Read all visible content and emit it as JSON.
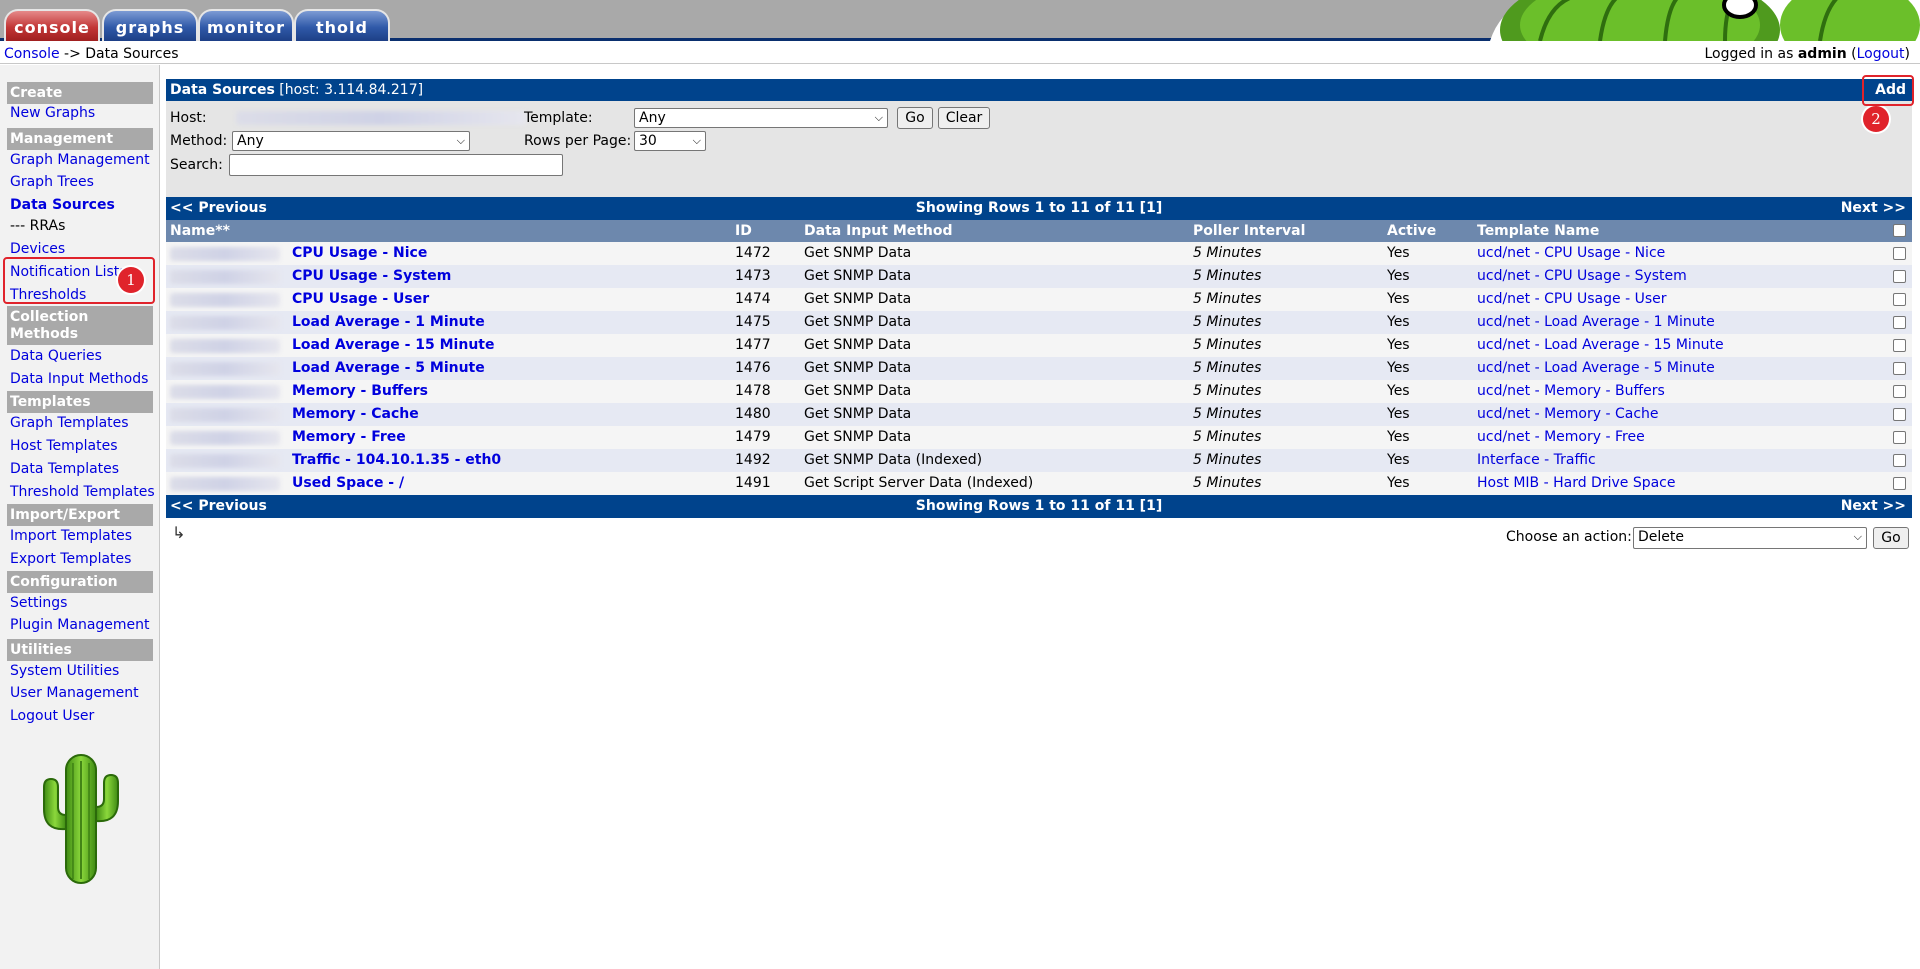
{
  "tabs": [
    {
      "label": "console",
      "active": true
    },
    {
      "label": "graphs"
    },
    {
      "label": "monitor"
    },
    {
      "label": "thold"
    }
  ],
  "breadcrumb": {
    "console": "Console",
    "separator": "->",
    "current": "Data Sources"
  },
  "login": {
    "prefix": "Logged in as",
    "user": "admin",
    "logout": "Logout"
  },
  "sidebar": {
    "sections": [
      {
        "heading": "Create",
        "items": [
          "New Graphs"
        ]
      },
      {
        "heading": "Management",
        "items": [
          "Graph Management",
          "Graph Trees",
          "Data Sources",
          "--- RRAs",
          "Devices",
          "Notification Lists",
          "Thresholds"
        ]
      },
      {
        "heading": "Collection Methods",
        "items": [
          "Data Queries",
          "Data Input Methods"
        ]
      },
      {
        "heading": "Templates",
        "items": [
          "Graph Templates",
          "Host Templates",
          "Data Templates",
          "Threshold Templates"
        ]
      },
      {
        "heading": "Import/Export",
        "items": [
          "Import Templates",
          "Export Templates"
        ]
      },
      {
        "heading": "Configuration",
        "items": [
          "Settings",
          "Plugin Management"
        ]
      },
      {
        "heading": "Utilities",
        "items": [
          "System Utilities",
          "User Management",
          "Logout User"
        ]
      }
    ]
  },
  "annotations": {
    "one": "1",
    "two": "2"
  },
  "panel": {
    "title": "Data Sources",
    "host_info": "[host: 3.114.84.217]",
    "add": "Add"
  },
  "filter": {
    "host_label": "Host:",
    "template_label": "Template:",
    "template_value": "Any",
    "go": "Go",
    "clear": "Clear",
    "method_label": "Method:",
    "method_value": "Any",
    "rows_label": "Rows per Page:",
    "rows_value": "30",
    "search_label": "Search:",
    "search_value": ""
  },
  "pagination": {
    "prev": "<< Previous",
    "showing": "Showing Rows 1 to 11 of 11 [1]",
    "next": "Next >>"
  },
  "table": {
    "headers": [
      "Name**",
      "ID",
      "Data Input Method",
      "Poller Interval",
      "Active",
      "Template Name"
    ],
    "rows": [
      {
        "name": "CPU Usage - Nice",
        "id": "1472",
        "method": "Get SNMP Data",
        "poller": "5 Minutes",
        "active": "Yes",
        "template": "ucd/net - CPU Usage - Nice"
      },
      {
        "name": "CPU Usage - System",
        "id": "1473",
        "method": "Get SNMP Data",
        "poller": "5 Minutes",
        "active": "Yes",
        "template": "ucd/net - CPU Usage - System"
      },
      {
        "name": "CPU Usage - User",
        "id": "1474",
        "method": "Get SNMP Data",
        "poller": "5 Minutes",
        "active": "Yes",
        "template": "ucd/net - CPU Usage - User"
      },
      {
        "name": "Load Average - 1 Minute",
        "id": "1475",
        "method": "Get SNMP Data",
        "poller": "5 Minutes",
        "active": "Yes",
        "template": "ucd/net - Load Average - 1 Minute"
      },
      {
        "name": "Load Average - 15 Minute",
        "id": "1477",
        "method": "Get SNMP Data",
        "poller": "5 Minutes",
        "active": "Yes",
        "template": "ucd/net - Load Average - 15 Minute"
      },
      {
        "name": "Load Average - 5 Minute",
        "id": "1476",
        "method": "Get SNMP Data",
        "poller": "5 Minutes",
        "active": "Yes",
        "template": "ucd/net - Load Average - 5 Minute"
      },
      {
        "name": "Memory - Buffers",
        "id": "1478",
        "method": "Get SNMP Data",
        "poller": "5 Minutes",
        "active": "Yes",
        "template": "ucd/net - Memory - Buffers"
      },
      {
        "name": "Memory - Cache",
        "id": "1480",
        "method": "Get SNMP Data",
        "poller": "5 Minutes",
        "active": "Yes",
        "template": "ucd/net - Memory - Cache"
      },
      {
        "name": "Memory - Free",
        "id": "1479",
        "method": "Get SNMP Data",
        "poller": "5 Minutes",
        "active": "Yes",
        "template": "ucd/net - Memory - Free"
      },
      {
        "name": "Traffic - 104.10.1.35 - eth0",
        "id": "1492",
        "method": "Get SNMP Data (Indexed)",
        "poller": "5 Minutes",
        "active": "Yes",
        "template": "Interface - Traffic"
      },
      {
        "name": "Used Space - /",
        "id": "1491",
        "method": "Get Script Server Data (Indexed)",
        "poller": "5 Minutes",
        "active": "Yes",
        "template": "Host MIB - Hard Drive Space"
      }
    ]
  },
  "actions": {
    "label": "Choose an action:",
    "value": "Delete",
    "go": "Go"
  },
  "colors": {
    "header_blue": "#00438c",
    "column_header": "#6d88ad",
    "link": "#0000dd",
    "annotation_red": "#e0232b"
  }
}
